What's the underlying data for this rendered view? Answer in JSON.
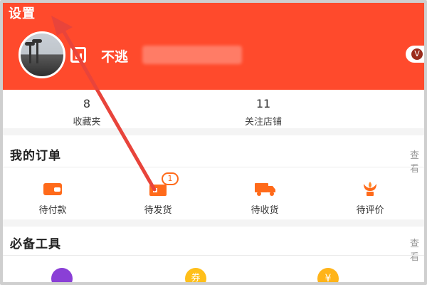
{
  "header": {
    "settings_label": "设置",
    "username": "不逃",
    "member_badge": "V"
  },
  "stats": [
    {
      "value": "8",
      "label": "收藏夹"
    },
    {
      "value": "11",
      "label": "关注店铺"
    }
  ],
  "orders": {
    "title": "我的订单",
    "more": "查看",
    "items": [
      {
        "label": "待付款",
        "icon": "wallet-icon",
        "badge": ""
      },
      {
        "label": "待发货",
        "icon": "package-icon",
        "badge": "1"
      },
      {
        "label": "待收货",
        "icon": "truck-icon",
        "badge": ""
      },
      {
        "label": "待评价",
        "icon": "flower-icon",
        "badge": ""
      }
    ]
  },
  "tools": {
    "title": "必备工具",
    "more": "查看",
    "items": [
      {
        "icon": "palette-icon",
        "text": ""
      },
      {
        "icon": "coupon-icon",
        "text": "券"
      },
      {
        "icon": "yuan-icon",
        "text": "¥"
      }
    ]
  },
  "colors": {
    "header_bg": "#ff4a2c",
    "accent_orange": "#ff6a1a",
    "annotation_arrow": "#e8443b"
  }
}
